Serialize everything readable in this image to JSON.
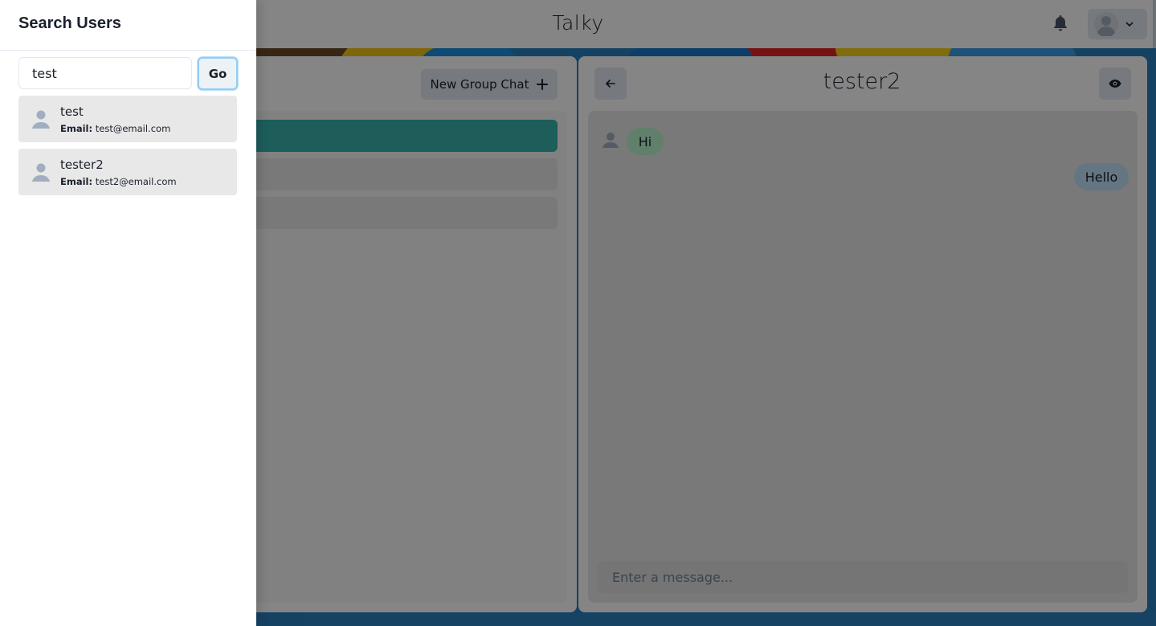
{
  "app": {
    "brand": "Talky",
    "new_group_label": "New Group Chat",
    "chat_title": "tester2",
    "messages": [
      {
        "text": "Hi",
        "direction": "incoming"
      },
      {
        "text": "Hello",
        "direction": "outgoing"
      }
    ],
    "message_placeholder": "Enter a message..."
  },
  "drawer": {
    "title": "Search Users",
    "search_value": "test",
    "go_label": "Go",
    "results": [
      {
        "name": "test",
        "email_label": "Email:",
        "email": "test@email.com"
      },
      {
        "name": "tester2",
        "email_label": "Email:",
        "email": "test2@email.com"
      }
    ]
  },
  "colors": {
    "active_chat": "#38b2ac",
    "incoming_bubble": "#b9f5d0",
    "outgoing_bubble": "#bee3f8",
    "go_focus_ring": "#90cdf4"
  },
  "icons": [
    "bell-icon",
    "avatar-icon",
    "chevron-down-icon",
    "plus-icon",
    "arrow-left-icon",
    "eye-icon",
    "user-avatar-icon"
  ]
}
